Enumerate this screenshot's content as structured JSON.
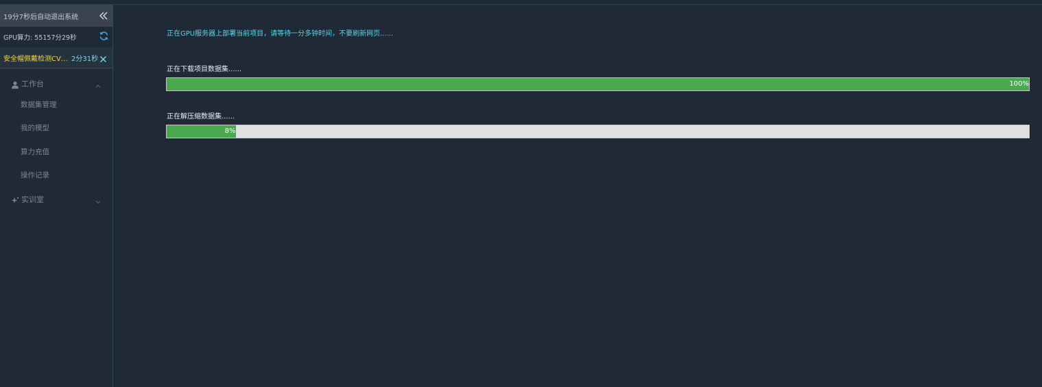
{
  "sidebar": {
    "countdown_text": "19分7秒后自动退出系统",
    "gpu_text": "GPU算力: 55157分29秒",
    "task": {
      "name": "安全帽佩戴检测CVPR",
      "time": "2分31秒"
    },
    "groups": [
      {
        "label": "工作台",
        "icon": "user-icon",
        "expanded": true
      },
      {
        "label": "实训室",
        "icon": "sparkle-icon",
        "expanded": false
      }
    ],
    "items": [
      {
        "label": "数据集管理"
      },
      {
        "label": "我的模型"
      },
      {
        "label": "算力充值"
      },
      {
        "label": "操作记录"
      }
    ]
  },
  "main": {
    "notice": "正在GPU服务器上部署当前项目，请等待一分多钟时间，不要刷新网页......",
    "steps": [
      {
        "label": "正在下载项目数据集......",
        "progress_percent": 100,
        "progress_text": "100%"
      },
      {
        "label": "正在解压缩数据集......",
        "progress_percent": 8,
        "progress_text": "8%"
      }
    ]
  },
  "colors": {
    "background": "#1f2a36",
    "accent_cyan": "#5fd3e6",
    "task_yellow": "#f2d64a",
    "progress_green": "#4aa84f",
    "progress_track": "#e1e1e1"
  }
}
